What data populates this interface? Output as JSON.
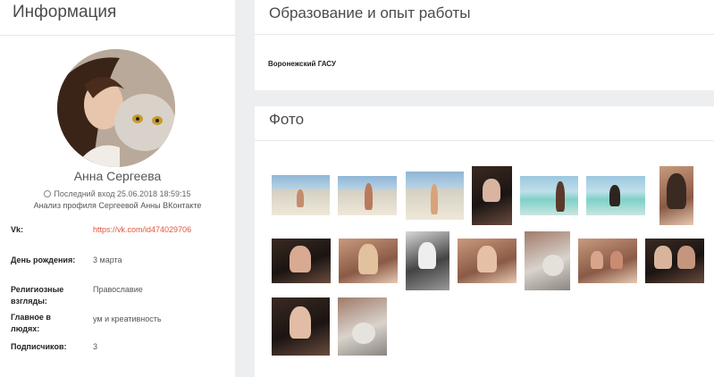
{
  "info_card": {
    "title": "Информация",
    "user_name": "Анна Сергеева",
    "last_seen": "Последний вход 25.06.2018 18:59:15",
    "analysis": "Анализ профиля Сергеевой Анны ВКонтакте",
    "fields": {
      "vk_label": "Vk:",
      "vk_value": "https://vk.com/id474029706",
      "birthday_label": "День рождения:",
      "birthday_value": "3 марта",
      "religion_label": "Религиозные взгляды:",
      "religion_value": "Православие",
      "main_label": "Главное в людях:",
      "main_value": "ум и креативность",
      "subs_label": "Подписчиков:",
      "subs_value": "3"
    }
  },
  "education_card": {
    "title": "Образование и опыт работы",
    "university": "Воронежский ГАСУ"
  },
  "photos_card": {
    "title": "Фото",
    "photo_count": 16
  },
  "colors": {
    "link": "#e0553c",
    "background": "#edeef0",
    "card": "#ffffff"
  }
}
